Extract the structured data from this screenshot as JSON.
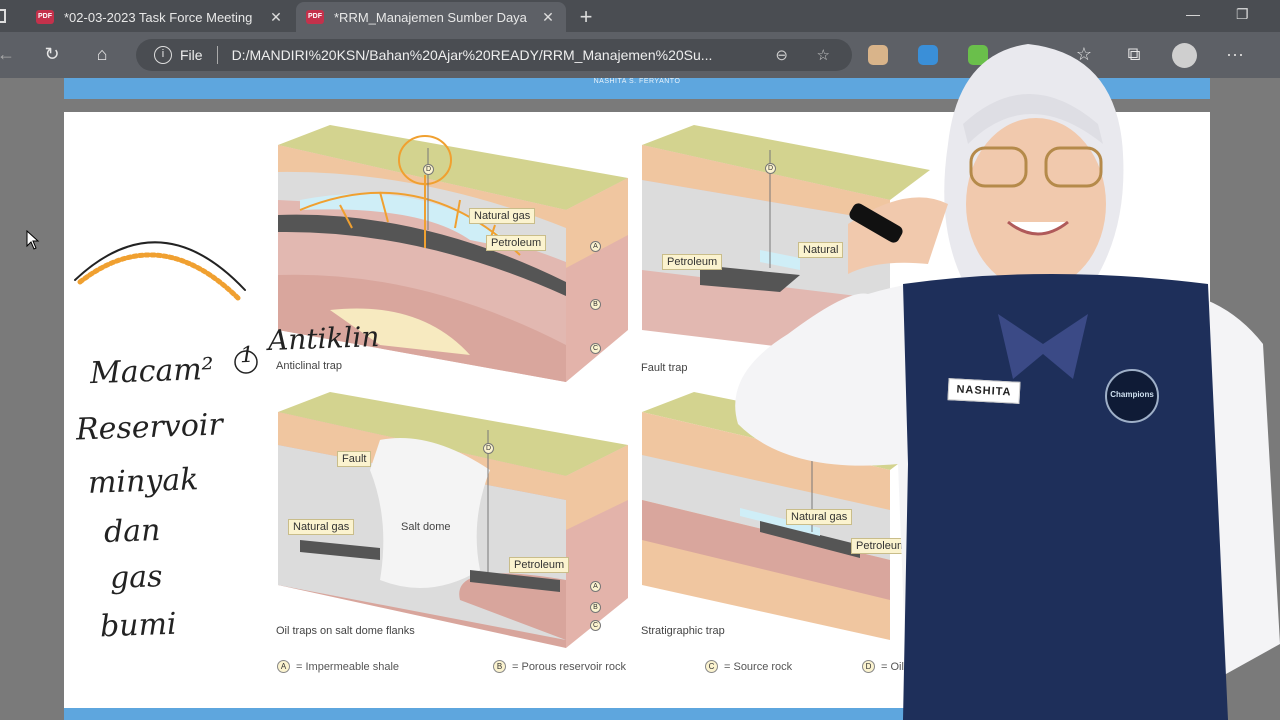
{
  "browser": {
    "tabs": [
      {
        "label": "*02-03-2023 Task Force Meeting",
        "close": "✕"
      },
      {
        "label": "*RRM_Manajemen Sumber Daya",
        "close": "✕"
      }
    ],
    "new_tab": "+",
    "address": {
      "scheme_label": "File",
      "url": "D:/MANDIRI%20KSN/Bahan%20Ajar%20READY/RRM_Manajemen%20Su..."
    },
    "icons": [
      "back-icon",
      "refresh-icon",
      "home-icon",
      "info-icon",
      "zoom-icon",
      "favorite-add-icon",
      "extension-icons",
      "favorites-icon",
      "collections-icon",
      "profile-icon",
      "more-icon"
    ]
  },
  "document": {
    "author_header": "NASHITA S. FERYANTO",
    "captions": {
      "anticlinal": "Anticlinal trap",
      "fault": "Fault trap",
      "salt_dome": "Oil traps on salt dome flanks",
      "stratigraphic": "Stratigraphic trap"
    },
    "callouts": {
      "natural_gas": "Natural gas",
      "petroleum": "Petroleum",
      "natural_partial": "Natural",
      "fault": "Fault",
      "salt_dome": "Salt dome"
    },
    "layer_marks": [
      "A",
      "B",
      "C",
      "D"
    ],
    "legend": [
      {
        "mark": "A",
        "label": "= Impermeable shale"
      },
      {
        "mark": "B",
        "label": "= Porous reservoir rock"
      },
      {
        "mark": "C",
        "label": "= Source rock"
      },
      {
        "mark": "D",
        "label": "= Oil"
      }
    ]
  },
  "handwriting": {
    "number": "1",
    "anticline": "Antiklin",
    "lines": [
      "Macam²",
      "Reservoir",
      "minyak",
      "dan",
      "gas",
      "bumi"
    ]
  },
  "presenter": {
    "name_tag": "NASHITA",
    "badge": "Champions"
  },
  "colors": {
    "header_blue": "#5ea6de",
    "topsoil": "#cfd08e",
    "sand": "#f0c6a0",
    "shale": "#d9d6d6",
    "source_rock": "#d8a8a0",
    "oil": "#555555",
    "gas": "#cfeef7",
    "annotation_orange": "#f0a030",
    "uniform_navy": "#1e2f5a"
  }
}
